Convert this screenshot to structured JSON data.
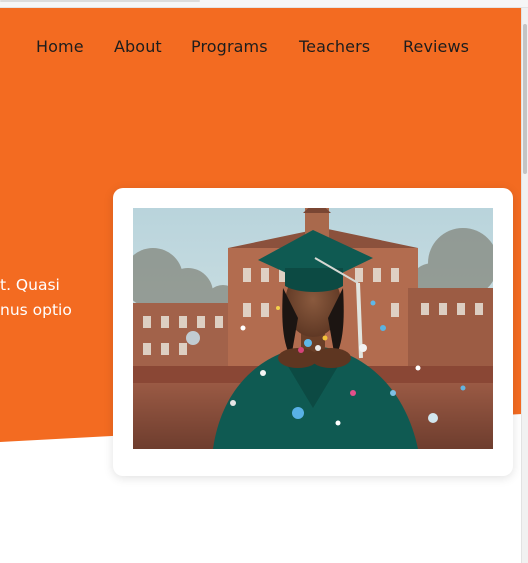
{
  "nav": {
    "items": [
      {
        "label": "Home"
      },
      {
        "label": "About"
      },
      {
        "label": "Programs"
      },
      {
        "label": "Teachers"
      },
      {
        "label": "Reviews"
      }
    ]
  },
  "hero": {
    "text_line1": "t. Quasi",
    "text_line2": "nus optio",
    "accent_color": "#f36b21"
  },
  "image": {
    "subject": "graduate in cap and gown blowing confetti"
  }
}
